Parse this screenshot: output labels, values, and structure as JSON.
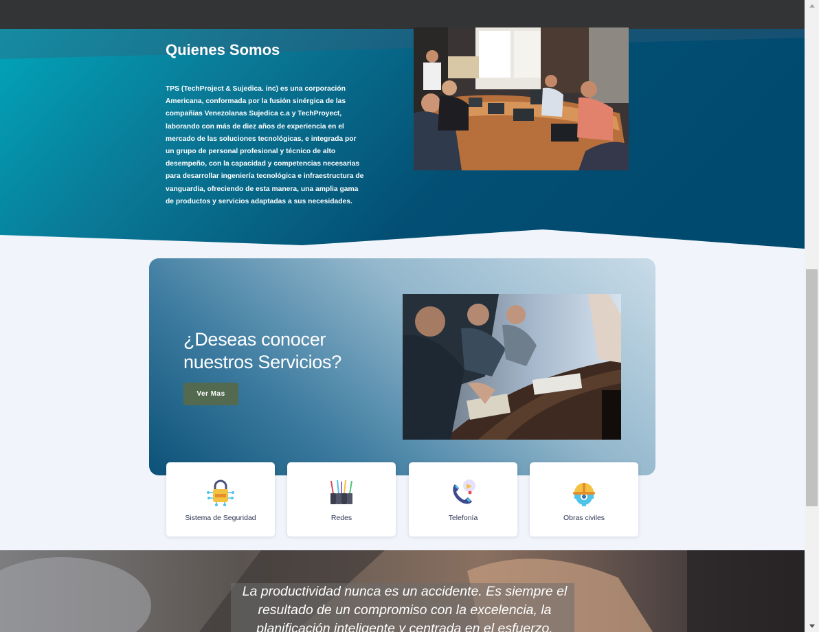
{
  "about": {
    "title": "Quienes Somos",
    "description": "TPS (TechProject & Sujedica. inc) es una corporación Americana, conformada por la fusión sinérgica de las compañías Venezolanas Sujedica c.a y TechProyect, laborando con más de diez años de experiencia en el mercado de las soluciones tecnológicas, e integrada por un grupo de personal profesional y técnico de alto desempeño, con la capacidad y competencias necesarias para desarrollar ingeniería tecnológica e infraestructura de vanguardia, ofreciendo de esta manera, una amplia gama de productos y servicios adaptadas a sus necesidades."
  },
  "cta": {
    "title_line1": "¿Deseas conocer",
    "title_line2": "nuestros Servicios?",
    "button_label": "Ver Mas"
  },
  "services": [
    {
      "label": "Sistema de Seguridad",
      "icon": "security-lock-icon"
    },
    {
      "label": "Redes",
      "icon": "network-cables-icon"
    },
    {
      "label": "Telefonía",
      "icon": "telephone-icon"
    },
    {
      "label": "Obras civiles",
      "icon": "construction-helmet-icon"
    }
  ],
  "quote": {
    "text": "La productividad nunca es un accidente. Es siempre el resultado de un compromiso con la excelencia, la planificación inteligente y centrada en el esfuerzo."
  },
  "colors": {
    "topbar": "#333436",
    "hero_start": "#00aabd",
    "hero_end": "#014d73",
    "page_bg": "#f1f5fb",
    "button": "#536a50",
    "card_text": "#2b3350"
  }
}
